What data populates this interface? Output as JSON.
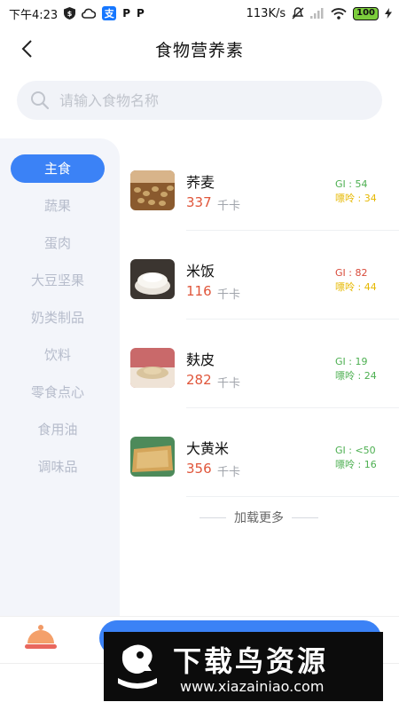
{
  "status_bar": {
    "time": "下午4:23",
    "speed": "113K/s",
    "battery": "100"
  },
  "header": {
    "title": "食物营养素"
  },
  "search": {
    "placeholder": "请输入食物名称"
  },
  "sidebar": {
    "items": [
      {
        "label": "主食",
        "active": true
      },
      {
        "label": "蔬果",
        "active": false
      },
      {
        "label": "蛋肉",
        "active": false
      },
      {
        "label": "大豆坚果",
        "active": false
      },
      {
        "label": "奶类制品",
        "active": false
      },
      {
        "label": "饮料",
        "active": false
      },
      {
        "label": "零食点心",
        "active": false
      },
      {
        "label": "食用油",
        "active": false
      },
      {
        "label": "调味品",
        "active": false
      }
    ]
  },
  "foods": [
    {
      "name": "荞麦",
      "kcal": "337",
      "unit": "千卡",
      "gi": "GI : 54",
      "gi_color": "#4caf50",
      "purine": "嘌呤 : 34",
      "purine_color": "#e6b800",
      "image_icon": "buckwheat-image"
    },
    {
      "name": "米饭",
      "kcal": "116",
      "unit": "千卡",
      "gi": "GI : 82",
      "gi_color": "#d84a3a",
      "purine": "嘌呤 : 44",
      "purine_color": "#e6b800",
      "image_icon": "rice-image"
    },
    {
      "name": "麸皮",
      "kcal": "282",
      "unit": "千卡",
      "gi": "GI : 19",
      "gi_color": "#4caf50",
      "purine": "嘌呤 : 24",
      "purine_color": "#4caf50",
      "image_icon": "bran-image"
    },
    {
      "name": "大黄米",
      "kcal": "356",
      "unit": "千卡",
      "gi": "GI : <50",
      "gi_color": "#4caf50",
      "purine": "嘌呤 : 16",
      "purine_color": "#4caf50",
      "image_icon": "millet-image"
    }
  ],
  "load_more": "加载更多",
  "watermark": {
    "brand": "下载鸟资源",
    "url": "www.xiazainiao.com"
  },
  "colors": {
    "accent": "#3b82f6",
    "kcal": "#e0563b"
  }
}
